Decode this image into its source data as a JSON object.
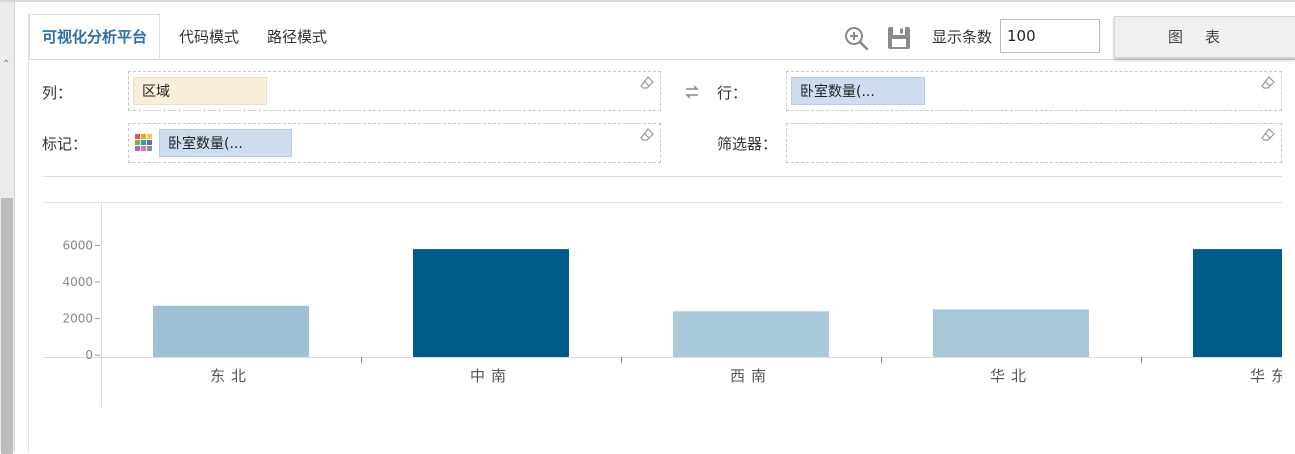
{
  "tabs": {
    "visual": "可视化分析平台",
    "code": "代码模式",
    "path": "路径模式"
  },
  "toolbar": {
    "limit_label": "显示条数",
    "limit_value": "100",
    "chart_button": "图表",
    "icons": [
      "zoom-in-icon",
      "save-icon"
    ]
  },
  "shelves": {
    "columns_label": "列：",
    "columns_pill": "区域",
    "rows_label": "行：",
    "rows_pill": "卧室数量(...",
    "marks_label": "标记：",
    "marks_pill": "卧室数量(...",
    "filter_label": "筛选器：",
    "swap_icon": "swap-icon",
    "eraser_icon": "eraser-icon"
  },
  "colors": {
    "accent": "#2b6fa8",
    "bar_dark": "#005b8a",
    "pill_dimension": "#f7eedb",
    "pill_measure": "#cfdcef"
  },
  "chart_data": {
    "type": "bar",
    "categories": [
      "东北",
      "中南",
      "西南",
      "华北",
      "华东"
    ],
    "values": [
      2700,
      5800,
      2400,
      2500,
      5800
    ],
    "bar_colors": [
      "#9dc1d5",
      "#005b8a",
      "#aac9da",
      "#a8c6d7",
      "#005b8a"
    ],
    "yticks": [
      0,
      2000,
      4000,
      6000
    ],
    "ylim": [
      -100,
      7500
    ],
    "title": "",
    "xlabel": "",
    "ylabel": "",
    "grid": false,
    "legend": "none"
  }
}
